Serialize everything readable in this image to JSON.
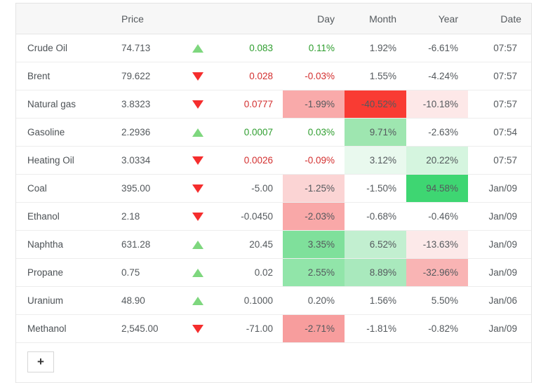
{
  "table": {
    "columns": [
      {
        "key": "name",
        "label": ""
      },
      {
        "key": "price",
        "label": "Price"
      },
      {
        "key": "arrow",
        "label": ""
      },
      {
        "key": "change",
        "label": ""
      },
      {
        "key": "day",
        "label": "Day"
      },
      {
        "key": "month",
        "label": "Month"
      },
      {
        "key": "year",
        "label": "Year"
      },
      {
        "key": "date",
        "label": "Date"
      }
    ],
    "rows": [
      {
        "name": "Crude Oil",
        "price": "74.713",
        "arrow": "up-triangle-icon",
        "change": "0.083",
        "change_tone": "up",
        "day": "0.11%",
        "day_tone": "up",
        "day_bg": "none",
        "month": "1.92%",
        "month_bg": "none",
        "year": "-6.61%",
        "year_bg": "none",
        "date": "07:57"
      },
      {
        "name": "Brent",
        "price": "79.622",
        "arrow": "down-triangle-icon",
        "change": "0.028",
        "change_tone": "down",
        "day": "-0.03%",
        "day_tone": "down",
        "day_bg": "none",
        "month": "1.55%",
        "month_bg": "none",
        "year": "-4.24%",
        "year_bg": "none",
        "date": "07:57"
      },
      {
        "name": "Natural gas",
        "price": "3.8323",
        "arrow": "down-triangle-icon",
        "change": "0.0777",
        "change_tone": "down",
        "day": "-1.99%",
        "day_tone": "neutral",
        "day_bg": "#f9aaaa",
        "month": "-40.52%",
        "month_bg": "#f93b33",
        "year": "-10.18%",
        "year_bg": "#fde8e8",
        "date": "07:57"
      },
      {
        "name": "Gasoline",
        "price": "2.2936",
        "arrow": "up-triangle-icon",
        "change": "0.0007",
        "change_tone": "up",
        "day": "0.03%",
        "day_tone": "up",
        "day_bg": "none",
        "month": "9.71%",
        "month_bg": "#9ee6b0",
        "year": "-2.63%",
        "year_bg": "none",
        "date": "07:54"
      },
      {
        "name": "Heating Oil",
        "price": "3.0334",
        "arrow": "down-triangle-icon",
        "change": "0.0026",
        "change_tone": "down",
        "day": "-0.09%",
        "day_tone": "down",
        "day_bg": "none",
        "month": "3.12%",
        "month_bg": "#e9f9ee",
        "year": "20.22%",
        "year_bg": "#d5f5df",
        "date": "07:57"
      },
      {
        "name": "Coal",
        "price": "395.00",
        "arrow": "down-triangle-icon",
        "change": "-5.00",
        "change_tone": "neutral",
        "day": "-1.25%",
        "day_tone": "neutral",
        "day_bg": "#fbd4d4",
        "month": "-1.50%",
        "month_bg": "none",
        "year": "94.58%",
        "year_bg": "#3ed672",
        "date": "Jan/09"
      },
      {
        "name": "Ethanol",
        "price": "2.18",
        "arrow": "down-triangle-icon",
        "change": "-0.0450",
        "change_tone": "neutral",
        "day": "-2.03%",
        "day_tone": "neutral",
        "day_bg": "#f9a8a8",
        "month": "-0.68%",
        "month_bg": "none",
        "year": "-0.46%",
        "year_bg": "none",
        "date": "Jan/09"
      },
      {
        "name": "Naphtha",
        "price": "631.28",
        "arrow": "up-triangle-icon",
        "change": "20.45",
        "change_tone": "neutral",
        "day": "3.35%",
        "day_tone": "neutral",
        "day_bg": "#7fe09b",
        "month": "6.52%",
        "month_bg": "#c2efd0",
        "year": "-13.63%",
        "year_bg": "#fce9e9",
        "date": "Jan/09"
      },
      {
        "name": "Propane",
        "price": "0.75",
        "arrow": "up-triangle-icon",
        "change": "0.02",
        "change_tone": "neutral",
        "day": "2.55%",
        "day_tone": "neutral",
        "day_bg": "#91e5a9",
        "month": "8.89%",
        "month_bg": "#a9e9bd",
        "year": "-32.96%",
        "year_bg": "#f9b4b4",
        "date": "Jan/09"
      },
      {
        "name": "Uranium",
        "price": "48.90",
        "arrow": "up-triangle-icon",
        "change": "0.1000",
        "change_tone": "neutral",
        "day": "0.20%",
        "day_tone": "neutral",
        "day_bg": "none",
        "month": "1.56%",
        "month_bg": "none",
        "year": "5.50%",
        "year_bg": "none",
        "date": "Jan/06"
      },
      {
        "name": "Methanol",
        "price": "2,545.00",
        "arrow": "down-triangle-icon",
        "change": "-71.00",
        "change_tone": "neutral",
        "day": "-2.71%",
        "day_tone": "neutral",
        "day_bg": "#f79d9d",
        "month": "-1.81%",
        "month_bg": "none",
        "year": "-0.82%",
        "year_bg": "none",
        "date": "Jan/09"
      }
    ]
  },
  "footer": {
    "add_label": "+"
  },
  "colors": {
    "up": "#2f9e2f",
    "down": "#d32f2f",
    "arrow_up": "#7ed77e",
    "arrow_down": "#f52d2d",
    "neutral_text": "#54595d",
    "header_bg": "#f7f7f7",
    "border": "#ededed"
  }
}
